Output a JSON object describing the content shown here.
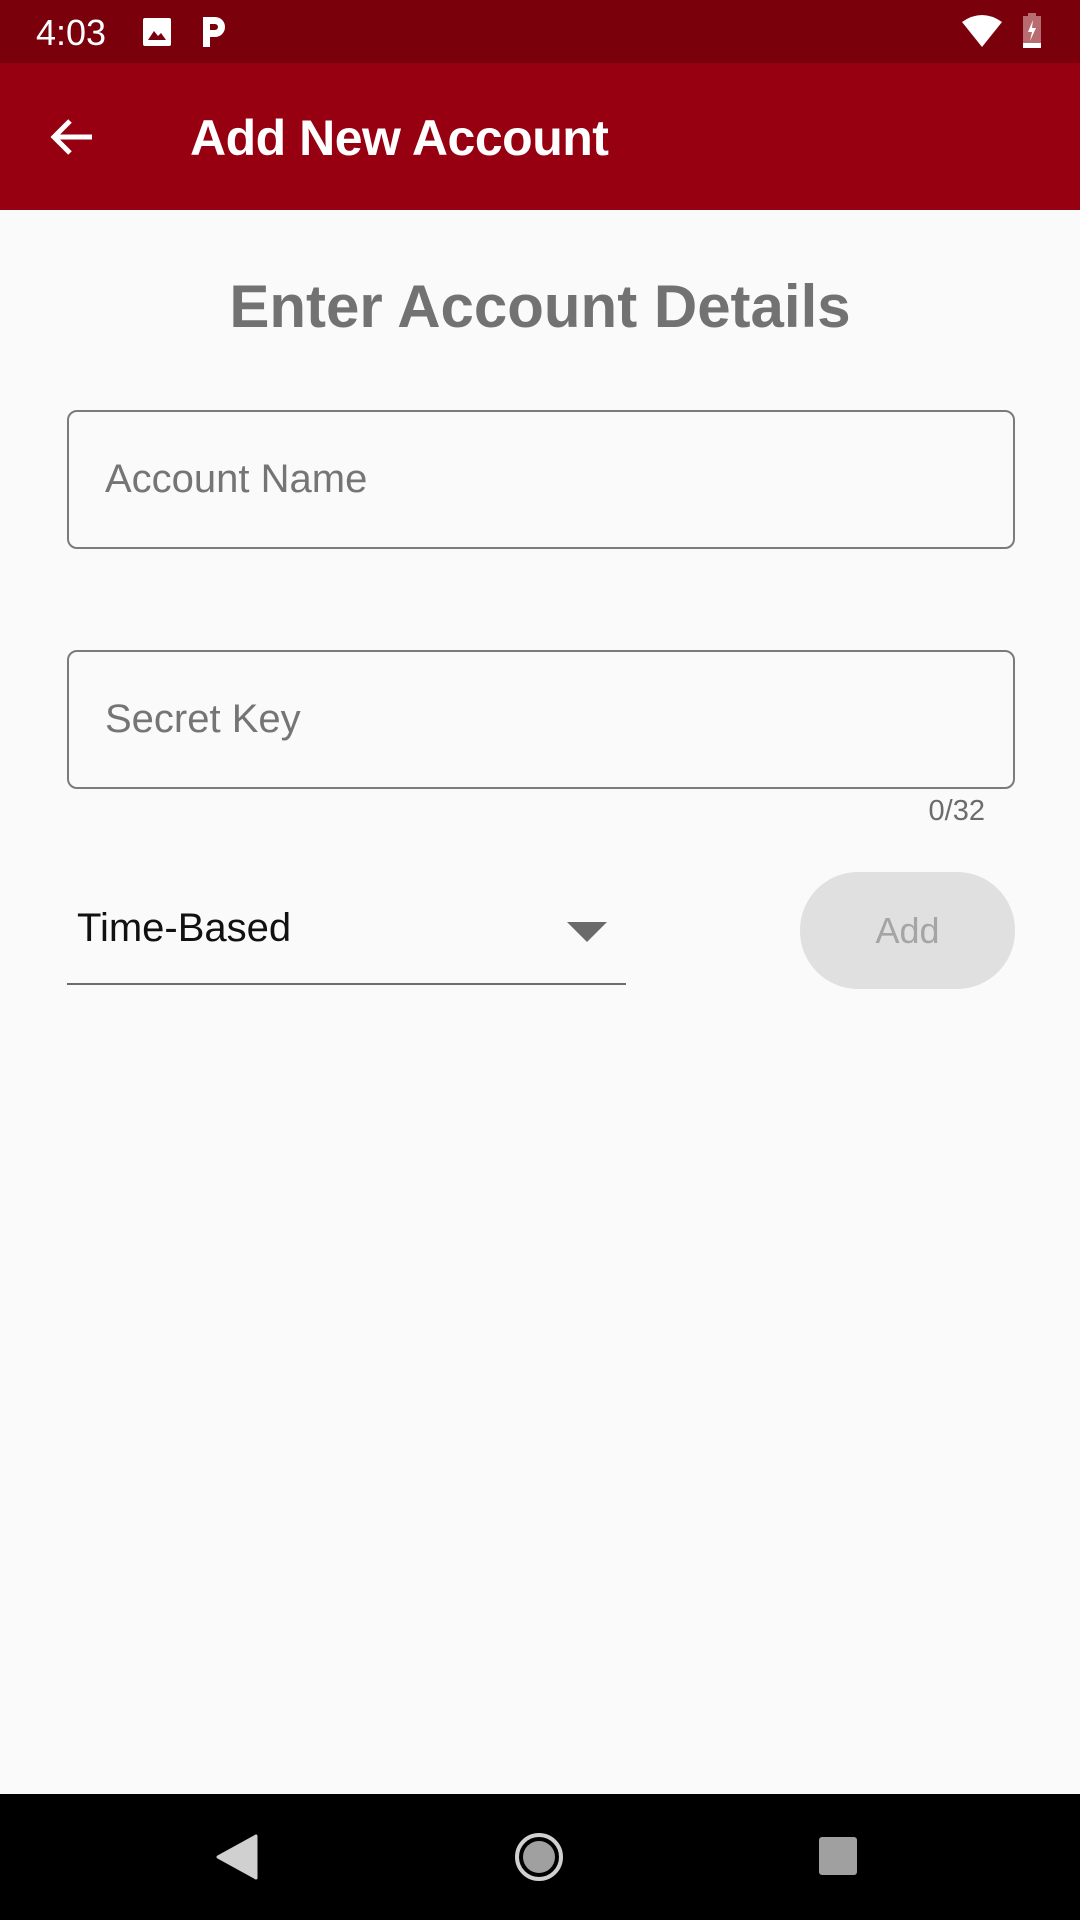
{
  "status_bar": {
    "time": "4:03",
    "icons": [
      "image-icon",
      "parking-icon",
      "wifi-icon",
      "battery-charging-icon"
    ]
  },
  "app_bar": {
    "title": "Add New Account",
    "back_icon": "arrow-left-icon"
  },
  "form": {
    "heading": "Enter Account Details",
    "account_name": {
      "value": "",
      "placeholder": "Account Name"
    },
    "secret_key": {
      "value": "",
      "placeholder": "Secret Key",
      "counter": "0/32"
    },
    "type_dropdown": {
      "selected": "Time-Based"
    },
    "add_button": {
      "label": "Add",
      "enabled": false
    }
  },
  "colors": {
    "status_bar": "#7a000c",
    "app_bar": "#970010",
    "background": "#fafafa",
    "button_disabled": "#e0e0e0"
  },
  "nav_bar": {
    "icons": [
      "back-triangle-icon",
      "home-circle-icon",
      "recents-square-icon"
    ]
  }
}
